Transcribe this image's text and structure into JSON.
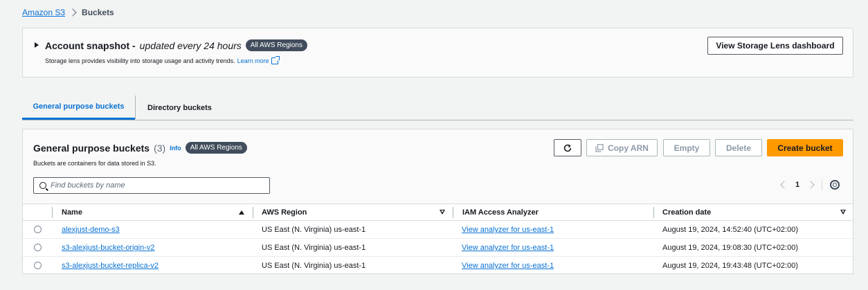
{
  "breadcrumb": {
    "root": "Amazon S3",
    "current": "Buckets"
  },
  "snapshot": {
    "title": "Account snapshot -",
    "updated": "updated every 24 hours",
    "badge": "All AWS Regions",
    "description": "Storage lens provides visibility into storage usage and activity trends.",
    "learn_more": "Learn more",
    "dashboard_button": "View Storage Lens dashboard"
  },
  "tabs": [
    {
      "label": "General purpose buckets",
      "active": true
    },
    {
      "label": "Directory buckets",
      "active": false
    }
  ],
  "panel": {
    "title": "General purpose buckets",
    "count": "(3)",
    "info": "Info",
    "badge": "All AWS Regions",
    "description": "Buckets are containers for data stored in S3.",
    "search_placeholder": "Find buckets by name",
    "buttons": {
      "copy_arn": "Copy ARN",
      "empty": "Empty",
      "delete": "Delete",
      "create": "Create bucket"
    },
    "page": "1"
  },
  "table": {
    "headers": {
      "name": "Name",
      "region": "AWS Region",
      "iam": "IAM Access Analyzer",
      "created": "Creation date"
    },
    "rows": [
      {
        "name": "alexjust-demo-s3",
        "region": "US East (N. Virginia) us-east-1",
        "iam": "View analyzer for us-east-1",
        "created": "August 19, 2024, 14:52:40 (UTC+02:00)"
      },
      {
        "name": "s3-alexjust-bucket-origin-v2",
        "region": "US East (N. Virginia) us-east-1",
        "iam": "View analyzer for us-east-1",
        "created": "August 19, 2024, 19:08:30 (UTC+02:00)"
      },
      {
        "name": "s3-alexjust-bucket-replica-v2",
        "region": "US East (N. Virginia) us-east-1",
        "iam": "View analyzer for us-east-1",
        "created": "August 19, 2024, 19:43:48 (UTC+02:00)"
      }
    ]
  },
  "colors": {
    "link": "#0972d3",
    "primary_button": "#ff9900",
    "badge": "#414d5c",
    "background": "#f2f3f3"
  },
  "icons": [
    "chevron-right-icon",
    "caret-right-icon",
    "external-link-icon",
    "refresh-icon",
    "copy-icon",
    "search-icon",
    "chevron-left-icon",
    "gear-icon",
    "sort-ascending-icon",
    "sort-icon"
  ]
}
